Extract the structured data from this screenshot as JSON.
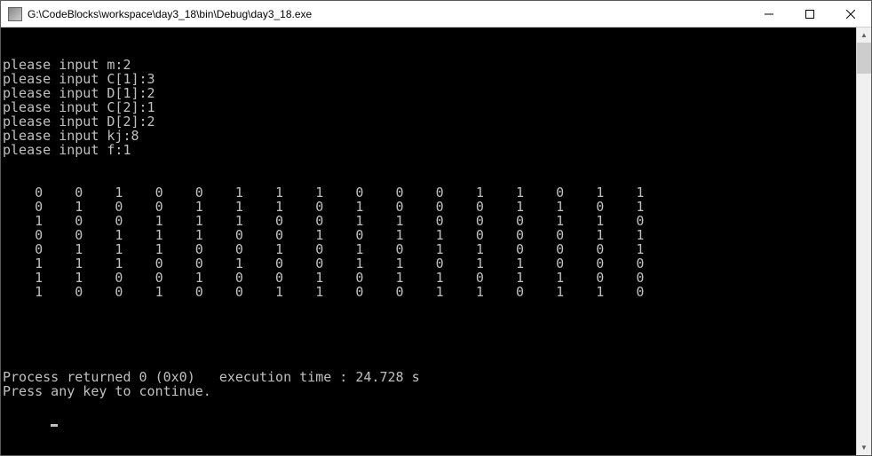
{
  "window": {
    "title": "G:\\CodeBlocks\\workspace\\day3_18\\bin\\Debug\\day3_18.exe"
  },
  "console": {
    "inputs": [
      "please input m:2",
      "please input C[1]:3",
      "please input D[1]:2",
      "please input C[2]:1",
      "please input D[2]:2",
      "please input kj:8",
      "please input f:1"
    ],
    "matrix": [
      [
        0,
        0,
        1,
        0,
        0,
        1,
        1,
        1,
        0,
        0,
        0,
        1,
        1,
        0,
        1,
        1
      ],
      [
        0,
        1,
        0,
        0,
        1,
        1,
        1,
        0,
        1,
        0,
        0,
        0,
        1,
        1,
        0,
        1
      ],
      [
        1,
        0,
        0,
        1,
        1,
        1,
        0,
        0,
        1,
        1,
        0,
        0,
        0,
        1,
        1,
        0
      ],
      [
        0,
        0,
        1,
        1,
        1,
        0,
        0,
        1,
        0,
        1,
        1,
        0,
        0,
        0,
        1,
        1
      ],
      [
        0,
        1,
        1,
        1,
        0,
        0,
        1,
        0,
        1,
        0,
        1,
        1,
        0,
        0,
        0,
        1
      ],
      [
        1,
        1,
        1,
        0,
        0,
        1,
        0,
        0,
        1,
        1,
        0,
        1,
        1,
        0,
        0,
        0
      ],
      [
        1,
        1,
        0,
        0,
        1,
        0,
        0,
        1,
        0,
        1,
        1,
        0,
        1,
        1,
        0,
        0
      ],
      [
        1,
        0,
        0,
        1,
        0,
        0,
        1,
        1,
        0,
        0,
        1,
        1,
        0,
        1,
        1,
        0
      ]
    ],
    "footer": [
      "Process returned 0 (0x0)   execution time : 24.728 s",
      "Press any key to continue."
    ]
  },
  "scroll": {
    "up_glyph": "▲",
    "down_glyph": "▼"
  }
}
